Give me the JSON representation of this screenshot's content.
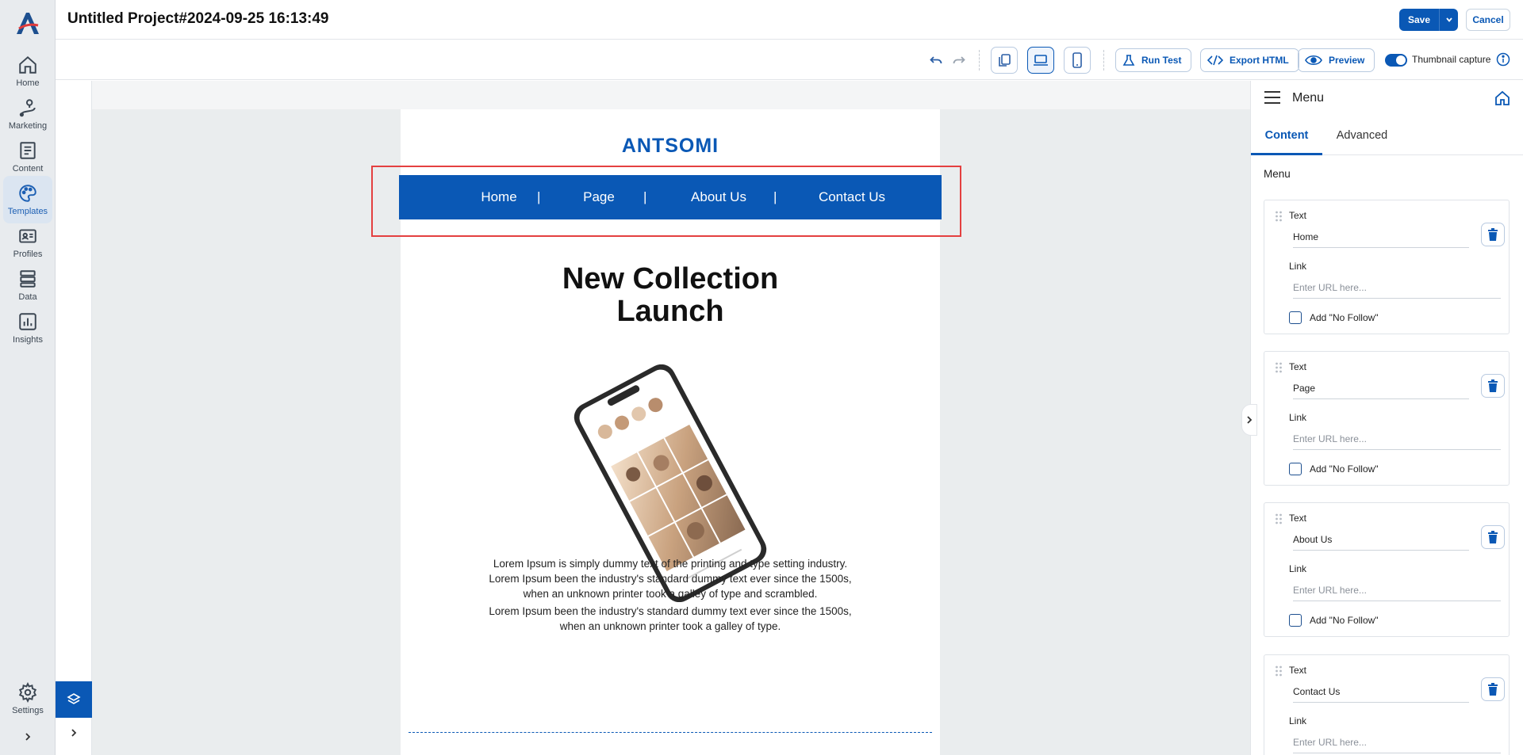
{
  "header": {
    "project_title": "Untitled Project#2024-09-25 16:13:49",
    "save_label": "Save",
    "cancel_label": "Cancel"
  },
  "rail": {
    "items": [
      {
        "label": "Home",
        "icon": "home-icon"
      },
      {
        "label": "Marketing",
        "icon": "marketing-icon"
      },
      {
        "label": "Content",
        "icon": "content-icon"
      },
      {
        "label": "Templates",
        "icon": "palette-icon",
        "active": true
      },
      {
        "label": "Profiles",
        "icon": "profile-card-icon"
      },
      {
        "label": "Data",
        "icon": "database-icon"
      },
      {
        "label": "Insights",
        "icon": "chart-icon"
      }
    ],
    "settings_label": "Settings"
  },
  "toolbar": {
    "run_test_label": "Run Test",
    "export_html_label": "Export HTML",
    "preview_label": "Preview",
    "thumbnail_label": "Thumbnail capture",
    "thumbnail_enabled": true
  },
  "email": {
    "brand": "ANTSOMI",
    "menu": [
      "Home",
      "Page",
      "About Us",
      "Contact Us"
    ],
    "menu_separator": "|",
    "headline_line1": "New Collection",
    "headline_line2": "Launch",
    "para1_line1": "Lorem Ipsum is simply dummy text of the printing and type setting industry.",
    "para1_line2": "Lorem Ipsum been the industry's standard dummy text ever since the 1500s,",
    "para1_line3": "when an unknown printer took a galley of type and scrambled.",
    "para2_line1": "Lorem Ipsum been the industry's standard dummy text ever since the 1500s,",
    "para2_line2": "when an unknown printer took a galley of type.",
    "accent_color": "#0a58b5",
    "selection_color": "#e44040"
  },
  "panel": {
    "title": "Menu",
    "tabs": [
      "Content",
      "Advanced"
    ],
    "active_tab": "Content",
    "section_label": "Menu",
    "text_label": "Text",
    "link_label": "Link",
    "link_placeholder": "Enter URL here...",
    "nofollow_label": "Add \"No Follow\"",
    "items": [
      {
        "text": "Home",
        "link": ""
      },
      {
        "text": "Page",
        "link": ""
      },
      {
        "text": "About Us",
        "link": ""
      },
      {
        "text": "Contact Us",
        "link": ""
      }
    ]
  }
}
